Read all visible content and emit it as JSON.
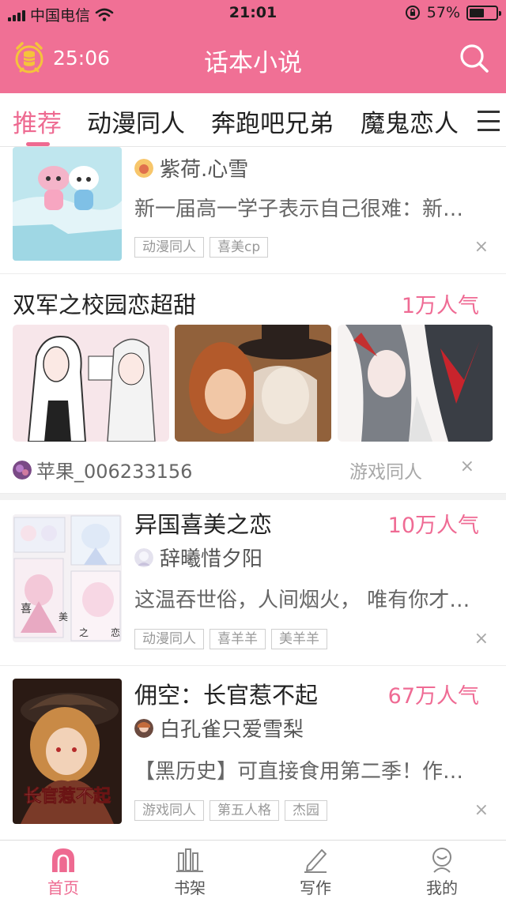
{
  "status_bar": {
    "carrier": "中国电信",
    "time": "21:01",
    "battery_percent": "57%",
    "battery_level": 0.57
  },
  "nav": {
    "timer": "25:06",
    "title": "话本小说"
  },
  "tabs": [
    "推荐",
    "动漫同人",
    "奔跑吧兄弟",
    "魔鬼恋人"
  ],
  "cards": {
    "c1": {
      "author": "紫荷.心雪",
      "desc": "新一届高一学子表示自己很难：新…",
      "tags": [
        "动漫同人",
        "喜美cp"
      ],
      "close": "×"
    },
    "c2": {
      "title": "双军之校园恋超甜",
      "popularity": "1万人气",
      "author": "苹果_006233156",
      "category": "游戏同人",
      "close": "×"
    },
    "c3": {
      "title": "异国喜美之恋",
      "popularity": "10万人气",
      "author": "辞曦惜夕阳",
      "desc": "这温吞世俗，人间烟火， 唯有你才…",
      "tags": [
        "动漫同人",
        "喜羊羊",
        "美羊羊"
      ],
      "cover_chars": [
        "喜",
        "美",
        "之",
        "恋"
      ],
      "close": "×"
    },
    "c4": {
      "title": "佣空：长官惹不起",
      "popularity": "67万人气",
      "author": "白孔雀只爱雪梨",
      "desc": "【黑历史】可直接食用第二季！作…",
      "tags": [
        "游戏同人",
        "第五人格",
        "杰园"
      ],
      "cover_text": "长官惹不起",
      "close": "×"
    }
  },
  "bottom_nav": [
    "首页",
    "书架",
    "写作",
    "我的"
  ],
  "colors": {
    "accent": "#f07095",
    "accent_text": "#ee6a91"
  }
}
